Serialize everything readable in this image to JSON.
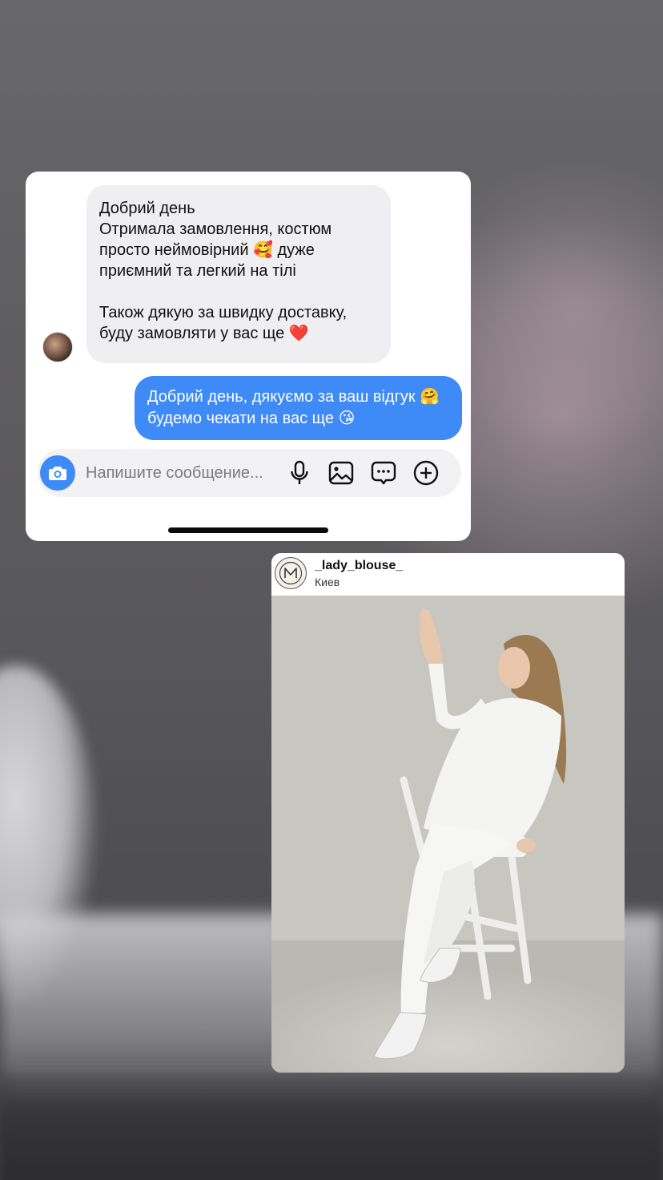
{
  "chat": {
    "incoming_message": "Добрий день\nОтримала замовлення, костюм просто неймовірний 🥰 дуже приємний та легкий на тілі\n\nТакож дякую за швидку доставку, буду замовляти у вас ще ❤️",
    "outgoing_message": "Добрий день, дякуємо за ваш відгук 🤗 будемо чекати на вас ще 😘",
    "composer": {
      "placeholder": "Напишите сообщение..."
    },
    "icons": [
      "camera-icon",
      "microphone-icon",
      "gallery-icon",
      "sticker-icon",
      "plus-icon"
    ],
    "accent_color": "#3e8af7"
  },
  "post": {
    "username": "_lady_blouse_",
    "location": "Киев",
    "logo_letter": "M"
  }
}
